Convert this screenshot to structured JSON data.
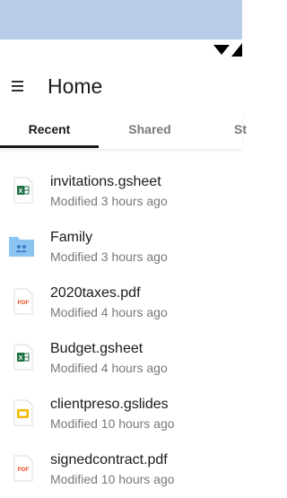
{
  "header": {
    "title": "Home"
  },
  "tabs": [
    {
      "label": "Recent",
      "active": true
    },
    {
      "label": "Shared",
      "active": false
    },
    {
      "label": "St",
      "active": false
    }
  ],
  "files": [
    {
      "name": "invitations.gsheet",
      "modified": "Modified 3 hours ago",
      "icon": "sheet-file-icon"
    },
    {
      "name": "Family",
      "modified": "Modified 3 hours ago",
      "icon": "shared-folder-icon"
    },
    {
      "name": "2020taxes.pdf",
      "modified": "Modified 4 hours ago",
      "icon": "pdf-file-icon",
      "icon_text": "PDF"
    },
    {
      "name": "Budget.gsheet",
      "modified": "Modified 4 hours ago",
      "icon": "sheet-file-icon"
    },
    {
      "name": "clientpreso.gslides",
      "modified": "Modified 10 hours ago",
      "icon": "slides-file-icon"
    },
    {
      "name": "signedcontract.pdf",
      "modified": "Modified 10 hours ago",
      "icon": "pdf-file-icon",
      "icon_text": "PDF"
    }
  ],
  "colors": {
    "top_band": "#b9cde8",
    "sheet_green": "#1f7244",
    "folder_blue": "#8bc4f0",
    "pdf_red": "#e8542b",
    "slides_yellow": "#f5b800",
    "text_primary": "#1e1919",
    "text_secondary": "#7b7877"
  }
}
